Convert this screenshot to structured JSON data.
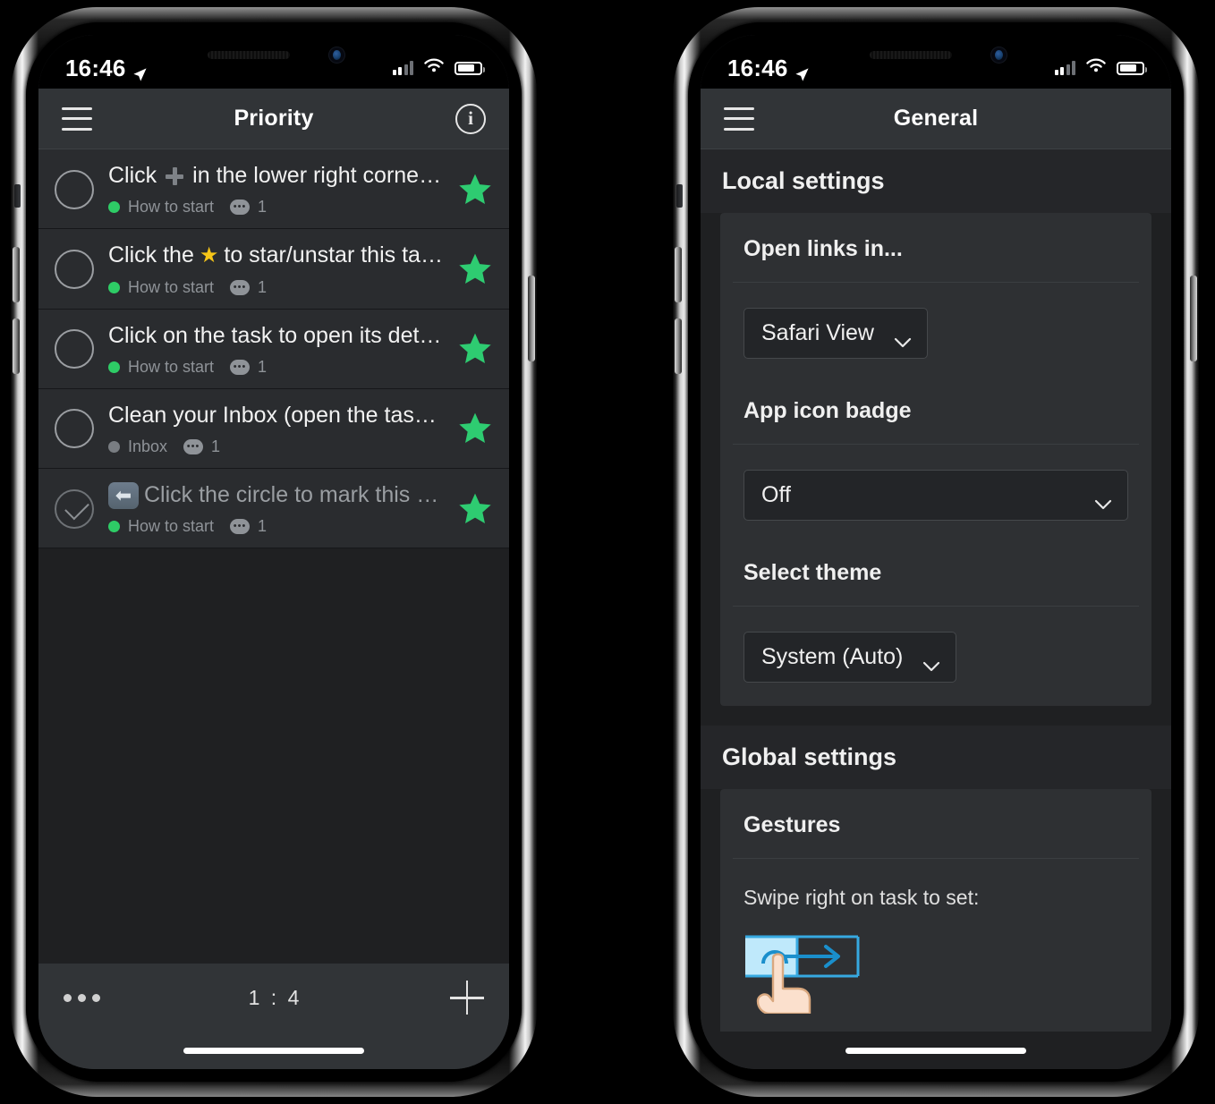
{
  "status_bar": {
    "time": "16:46",
    "location_icon": "location-arrow-icon",
    "signal_icon": "cellular-bars-icon",
    "wifi_icon": "wifi-icon",
    "battery_icon": "battery-icon"
  },
  "left_phone": {
    "nav": {
      "menu_icon": "hamburger-menu-icon",
      "title": "Priority",
      "info_icon": "info-icon",
      "info_glyph": "i"
    },
    "tasks": [
      {
        "title_before": "Click",
        "inline_icon": "plus-icon",
        "title_after": "in the lower right corner t...",
        "list": "How to start",
        "list_dot_color": "#2ecc66",
        "comments": "1",
        "starred": true,
        "completed": false
      },
      {
        "title_before": "Click the",
        "inline_icon": "star-emoji",
        "title_after": "to star/unstar this tas...",
        "list": "How to start",
        "list_dot_color": "#2ecc66",
        "comments": "1",
        "starred": true,
        "completed": false
      },
      {
        "title_before": "",
        "inline_icon": "",
        "title_after": "Click on the task to open its details...",
        "list": "How to start",
        "list_dot_color": "#2ecc66",
        "comments": "1",
        "starred": true,
        "completed": false
      },
      {
        "title_before": "",
        "inline_icon": "",
        "title_after": "Clean your Inbox (open the task fo...",
        "list": "Inbox",
        "list_dot_color": "#797d82",
        "comments": "1",
        "starred": true,
        "completed": false
      },
      {
        "title_before": "",
        "inline_icon": "left-arrow-badge-icon",
        "title_after": "Click the circle to mark this tas...",
        "list": "How to start",
        "list_dot_color": "#2ecc66",
        "comments": "1",
        "starred": true,
        "completed": true
      }
    ],
    "toolbar": {
      "more_icon": "more-dots-icon",
      "counter": "1 : 4",
      "add_icon": "plus-icon"
    }
  },
  "right_phone": {
    "nav": {
      "menu_icon": "hamburger-menu-icon",
      "title": "General"
    },
    "sections": [
      {
        "header": "Local settings",
        "cards": [
          {
            "title": "Open links in...",
            "control": "dropdown",
            "value": "Safari View",
            "wide": false
          },
          {
            "title": "App icon badge",
            "control": "dropdown",
            "value": "Off",
            "wide": true
          },
          {
            "title": "Select theme",
            "control": "dropdown",
            "value": "System (Auto)",
            "wide": false
          }
        ]
      },
      {
        "header": "Global settings",
        "cards": [
          {
            "title": "Gestures",
            "control": "gesture",
            "note": "Swipe right on task to set:",
            "gesture_icon": "swipe-right-hand-icon"
          }
        ]
      }
    ]
  },
  "colors": {
    "accent_green": "#2ecc71",
    "list_dot_green": "#2ecc66",
    "list_dot_grey": "#797d82",
    "screen_bg": "#1f2022",
    "card_bg": "#2e3033",
    "navbar_bg": "#313437",
    "row_bg": "#2a2c2f",
    "swipe_blue": "#1e9fe0"
  }
}
